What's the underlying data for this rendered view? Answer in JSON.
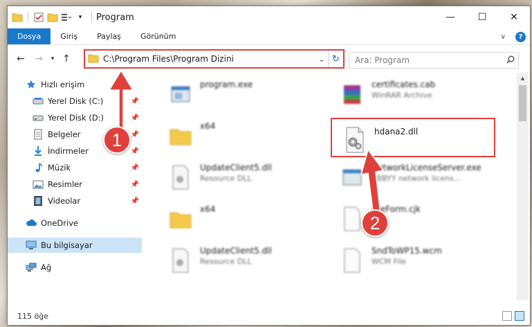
{
  "window": {
    "title": "Program"
  },
  "ribbon": {
    "tabs": [
      {
        "label": "Dosya",
        "active": true
      },
      {
        "label": "Giriş"
      },
      {
        "label": "Paylaş"
      },
      {
        "label": "Görünüm"
      }
    ],
    "help_label": "?"
  },
  "address": {
    "path": "C:\\Program Files\\Program Dizini"
  },
  "search": {
    "placeholder": "Ara: Program"
  },
  "sidebar": {
    "items": [
      {
        "label": "Hızlı erişim",
        "icon": "star-icon"
      },
      {
        "label": "Yerel Disk (C:)",
        "icon": "drive-icon",
        "pinned": true
      },
      {
        "label": "Yerel Disk (D:)",
        "icon": "drive-icon",
        "pinned": true
      },
      {
        "label": "Belgeler",
        "icon": "documents-icon",
        "pinned": true
      },
      {
        "label": "İndirmeler",
        "icon": "download-icon",
        "pinned": true
      },
      {
        "label": "Müzik",
        "icon": "music-icon",
        "pinned": true
      },
      {
        "label": "Resimler",
        "icon": "pictures-icon",
        "pinned": true
      },
      {
        "label": "Videolar",
        "icon": "video-icon",
        "pinned": true
      },
      {
        "label": "OneDrive",
        "icon": "cloud-icon"
      },
      {
        "label": "Bu bilgisayar",
        "icon": "computer-icon",
        "selected": true
      },
      {
        "label": "Ağ",
        "icon": "network-icon"
      }
    ]
  },
  "files": [
    {
      "name": "program.exe",
      "type": "",
      "icon": "exe-icon"
    },
    {
      "name": "certificates.cab",
      "type": "WinRAR Archive",
      "icon": "archive-icon"
    },
    {
      "name": "x64",
      "type": "",
      "icon": "folder-icon"
    },
    {
      "name": "hdana2.dll",
      "type": "",
      "icon": "dll-gear-icon"
    },
    {
      "name": "UpdateClient5.dll",
      "type": "Resource DLL",
      "icon": "dll-icon"
    },
    {
      "name": "NetworkLicenseServer.exe",
      "type": "ABBYY network licens...",
      "icon": "exe-icon"
    },
    {
      "name": "x64",
      "type": "",
      "icon": "folder-icon"
    },
    {
      "name": "FileForm.cjk",
      "type": "",
      "icon": "file-icon"
    },
    {
      "name": "UpdateClient5.dll",
      "type": "Resource DLL",
      "icon": "dll-icon"
    },
    {
      "name": "SndToWP15.wcm",
      "type": "WCM File",
      "icon": "file-icon"
    }
  ],
  "status": {
    "item_count": "115 öğe"
  },
  "annotations": {
    "step1": "1",
    "step2": "2"
  },
  "colors": {
    "accent": "#1979ca",
    "highlight": "#e0403c"
  }
}
